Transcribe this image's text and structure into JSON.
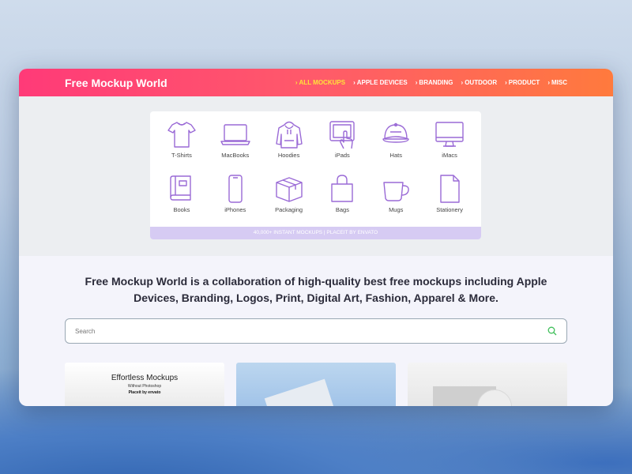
{
  "header": {
    "brand": "Free Mockup World",
    "nav": [
      {
        "label": "ALL MOCKUPS",
        "active": true
      },
      {
        "label": "APPLE DEVICES",
        "active": false
      },
      {
        "label": "BRANDING",
        "active": false
      },
      {
        "label": "OUTDOOR",
        "active": false
      },
      {
        "label": "PRODUCT",
        "active": false
      },
      {
        "label": "MISC",
        "active": false
      }
    ],
    "chevron": "›"
  },
  "categories": [
    {
      "label": "T-Shirts",
      "icon": "tshirt-icon"
    },
    {
      "label": "MacBooks",
      "icon": "laptop-icon"
    },
    {
      "label": "Hoodies",
      "icon": "hoodie-icon"
    },
    {
      "label": "iPads",
      "icon": "tablet-icon"
    },
    {
      "label": "Hats",
      "icon": "cap-icon"
    },
    {
      "label": "iMacs",
      "icon": "monitor-icon"
    },
    {
      "label": "Books",
      "icon": "book-icon"
    },
    {
      "label": "iPhones",
      "icon": "phone-icon"
    },
    {
      "label": "Packaging",
      "icon": "box-icon"
    },
    {
      "label": "Bags",
      "icon": "bag-icon"
    },
    {
      "label": "Mugs",
      "icon": "mug-icon"
    },
    {
      "label": "Stationery",
      "icon": "document-icon"
    }
  ],
  "promo_strip": "40,000+ INSTANT MOCKUPS | PLACEIT BY ENVATO",
  "intro": {
    "line1": "Free Mockup World is a collaboration of high-quality best free mockups including Apple",
    "line2": "Devices, Branding, Logos, Print, Digital Art, Fashion, Apparel & More."
  },
  "search": {
    "placeholder": "Search",
    "icon": "search-icon"
  },
  "cards": [
    {
      "title": "Effortless Mockups",
      "subtitle": "Without Photoshop",
      "brand": "Placeit by envato"
    }
  ],
  "colors": {
    "accent_from": "#ff3a78",
    "accent_to": "#ff7a3d",
    "nav_active": "#ffe23a",
    "icon_purple": "#9a6ad6",
    "search_icon": "#3fbf5a"
  }
}
